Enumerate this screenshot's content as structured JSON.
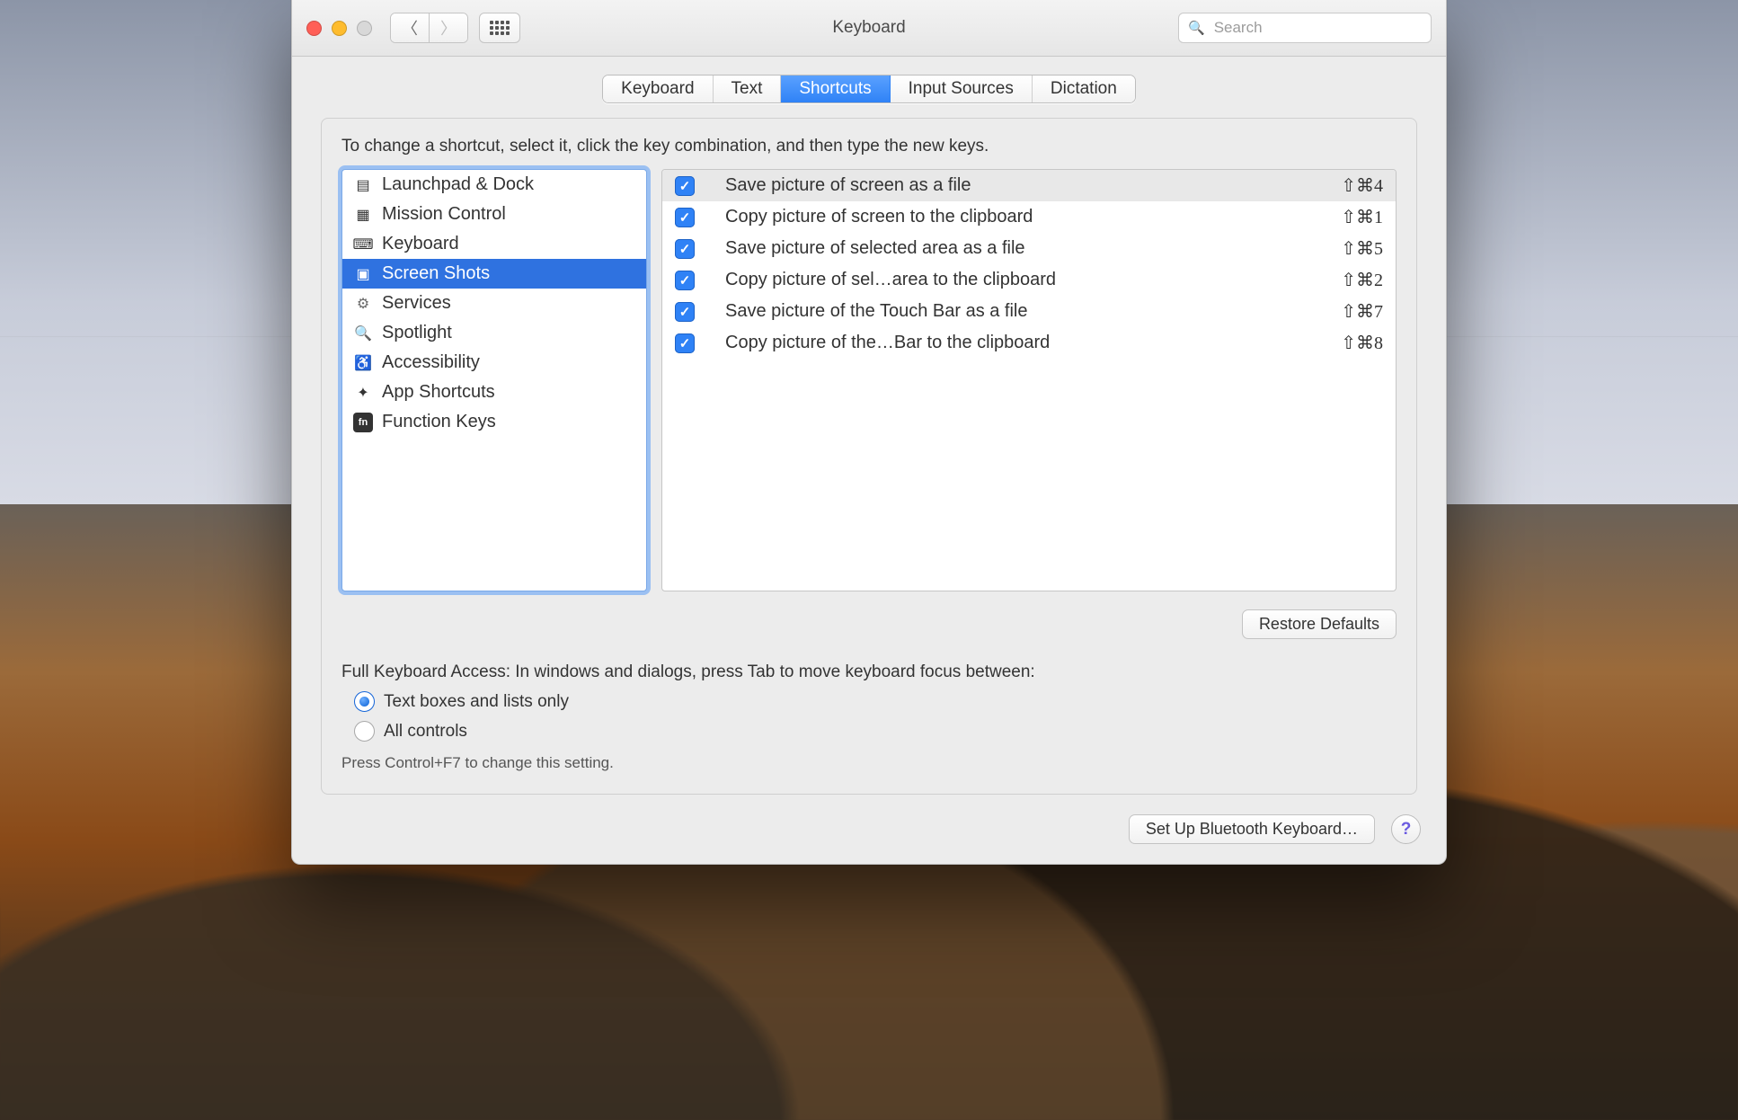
{
  "window": {
    "title": "Keyboard",
    "search_placeholder": "Search"
  },
  "tabs": [
    {
      "label": "Keyboard",
      "active": false
    },
    {
      "label": "Text",
      "active": false
    },
    {
      "label": "Shortcuts",
      "active": true
    },
    {
      "label": "Input Sources",
      "active": false
    },
    {
      "label": "Dictation",
      "active": false
    }
  ],
  "panel": {
    "instructions": "To change a shortcut, select it, click the key combination, and then type the new keys.",
    "categories": [
      {
        "label": "Launchpad & Dock",
        "icon": "rocket",
        "selected": false
      },
      {
        "label": "Mission Control",
        "icon": "mission",
        "selected": false
      },
      {
        "label": "Keyboard",
        "icon": "keyboard",
        "selected": false
      },
      {
        "label": "Screen Shots",
        "icon": "screenshot",
        "selected": true
      },
      {
        "label": "Services",
        "icon": "gear",
        "selected": false
      },
      {
        "label": "Spotlight",
        "icon": "spotlight",
        "selected": false
      },
      {
        "label": "Accessibility",
        "icon": "accessibility",
        "selected": false
      },
      {
        "label": "App Shortcuts",
        "icon": "apps",
        "selected": false
      },
      {
        "label": "Function Keys",
        "icon": "fn",
        "selected": false
      }
    ],
    "shortcuts": [
      {
        "checked": true,
        "label": "Save picture of screen as a file",
        "keys": "⇧⌘4",
        "selected": true
      },
      {
        "checked": true,
        "label": "Copy picture of screen to the clipboard",
        "keys": "⇧⌘1",
        "selected": false
      },
      {
        "checked": true,
        "label": "Save picture of selected area as a file",
        "keys": "⇧⌘5",
        "selected": false
      },
      {
        "checked": true,
        "label": "Copy picture of sel…area to the clipboard",
        "keys": "⇧⌘2",
        "selected": false
      },
      {
        "checked": true,
        "label": "Save picture of the Touch Bar as a file",
        "keys": "⇧⌘7",
        "selected": false
      },
      {
        "checked": true,
        "label": "Copy picture of the…Bar to the clipboard",
        "keys": "⇧⌘8",
        "selected": false
      }
    ],
    "restore_button": "Restore Defaults",
    "fka_title": "Full Keyboard Access: In windows and dialogs, press Tab to move keyboard focus between:",
    "fka_options": [
      {
        "label": "Text boxes and lists only",
        "checked": true
      },
      {
        "label": "All controls",
        "checked": false
      }
    ],
    "fka_hint": "Press Control+F7 to change this setting."
  },
  "footer": {
    "bluetooth_button": "Set Up Bluetooth Keyboard…",
    "help_glyph": "?"
  }
}
